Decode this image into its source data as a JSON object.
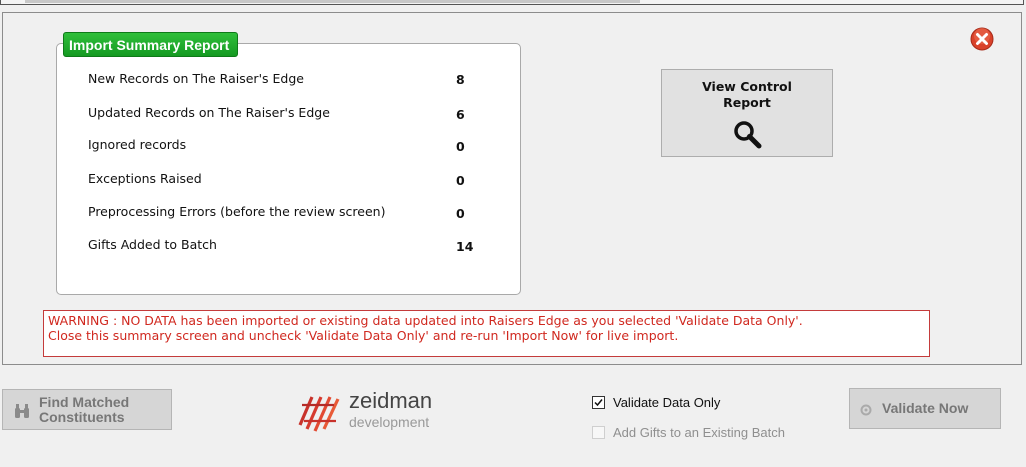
{
  "summary": {
    "title": "Import Summary Report",
    "rows": [
      {
        "label": "New Records on The Raiser's Edge",
        "value": "8"
      },
      {
        "label": "Updated Records on The Raiser's Edge",
        "value": "6"
      },
      {
        "label": "Ignored records",
        "value": "0"
      },
      {
        "label": "Exceptions Raised",
        "value": "0"
      },
      {
        "label": "Preprocessing Errors (before the review screen)",
        "value": "0"
      },
      {
        "label": "Gifts Added to Batch",
        "value": "14"
      }
    ]
  },
  "view_control": {
    "line1": "View Control",
    "line2": "Report",
    "icon": "magnifier-icon"
  },
  "warning": {
    "line1": "WARNING : NO DATA has been imported or existing data updated into Raisers Edge as you selected 'Validate Data Only'.",
    "line2": "Close this summary screen and uncheck 'Validate Data Only' and re-run 'Import Now' for live import."
  },
  "buttons": {
    "find_line1": "Find Matched",
    "find_line2": "Constituents",
    "validate": "Validate Now"
  },
  "logo": {
    "name": "zeidman",
    "sub": "development"
  },
  "options": {
    "validate_only": {
      "label": "Validate Data Only",
      "checked": true
    },
    "add_gifts": {
      "label": "Add Gifts to an Existing Batch",
      "checked": false
    }
  },
  "colors": {
    "title_green": "#159a22",
    "warning_red": "#d0281f",
    "close_red": "#d9412a"
  }
}
